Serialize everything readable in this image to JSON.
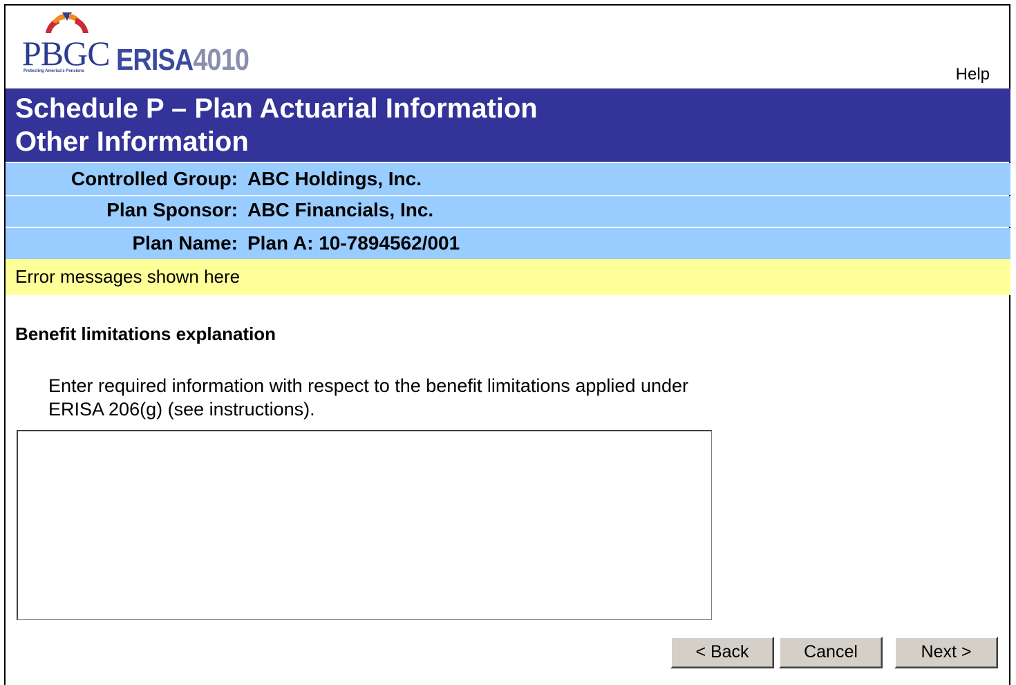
{
  "header": {
    "logo": {
      "pbgc_text": "PBGC",
      "erisa_text": "ERISA",
      "erisa_number": "4010",
      "tagline": "Protecting America's Pensions",
      "colors": {
        "primary": "#2e3c8f",
        "accent_red": "#cc2a36",
        "accent_orange": "#f08c1e"
      }
    },
    "help_label": "Help"
  },
  "title": {
    "line1": "Schedule P – Plan Actuarial Information",
    "line2": "Other Information",
    "background": "#333399"
  },
  "info": {
    "controlled_group_label": "Controlled Group:",
    "controlled_group_value": "ABC Holdings, Inc.",
    "plan_sponsor_label": "Plan Sponsor:",
    "plan_sponsor_value": "ABC Financials, Inc.",
    "plan_name_label": "Plan Name:",
    "plan_name_value": "Plan A: 10-7894562/001",
    "background": "#99ccff"
  },
  "error": {
    "message": "Error messages shown here",
    "background": "#ffff99"
  },
  "main": {
    "section_heading": "Benefit limitations explanation",
    "instructions": "Enter required information with respect to the benefit limitations applied under ERISA 206(g) (see instructions).",
    "textarea_value": ""
  },
  "buttons": {
    "back_label": "< Back",
    "cancel_label": "Cancel",
    "next_label": "Next >"
  }
}
